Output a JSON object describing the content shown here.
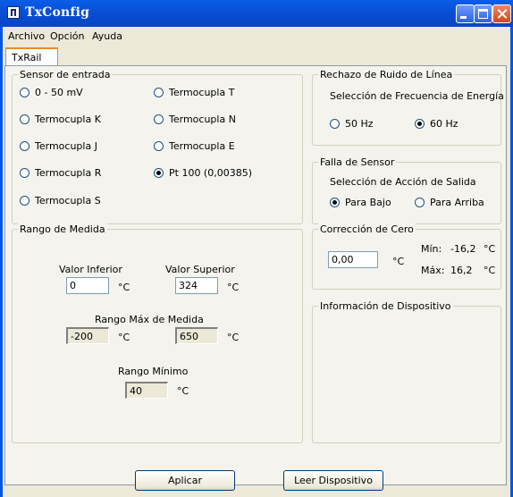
{
  "window": {
    "title": "TxConfig"
  },
  "menu": {
    "archivo": "Archivo",
    "opcion": "Opción",
    "ayuda": "Ayuda"
  },
  "tabs": [
    {
      "label": "TxRail"
    }
  ],
  "sensor": {
    "title": "Sensor de entrada",
    "options": [
      "0 - 50 mV",
      "Termocupla K",
      "Termocupla J",
      "Termocupla R",
      "Termocupla S",
      "Termocupla T",
      "Termocupla N",
      "Termocupla E",
      "Pt 100 (0,00385)"
    ],
    "selected": "Pt 100 (0,00385)"
  },
  "rechazo": {
    "title": "Rechazo de Ruido de Línea",
    "subtitle": "Selección de Frecuencia de Energía",
    "options": [
      "50 Hz",
      "60 Hz"
    ],
    "selected": "60 Hz"
  },
  "falla": {
    "title": "Falla de Sensor",
    "subtitle": "Selección de Acción de Salida",
    "options": [
      "Para Bajo",
      "Para Arriba"
    ],
    "selected": "Para Bajo"
  },
  "rango": {
    "title": "Rango de Medida",
    "inferior_label": "Valor Inferior",
    "inferior_value": "0",
    "superior_label": "Valor Superior",
    "superior_value": "324",
    "max_label": "Rango Máx de Medida",
    "max_low": "-200",
    "max_high": "650",
    "min_label": "Rango Mínimo",
    "min_value": "40",
    "unit": "°C"
  },
  "cero": {
    "title": "Corrección de Cero",
    "value": "0,00",
    "unit": "°C",
    "min_label": "Mín:",
    "min_value": "-16,2",
    "max_label": "Máx:",
    "max_value": "16,2"
  },
  "info": {
    "title": "Información de Dispositivo"
  },
  "buttons": {
    "aplicar": "Aplicar",
    "leer": "Leer Dispositivo"
  }
}
